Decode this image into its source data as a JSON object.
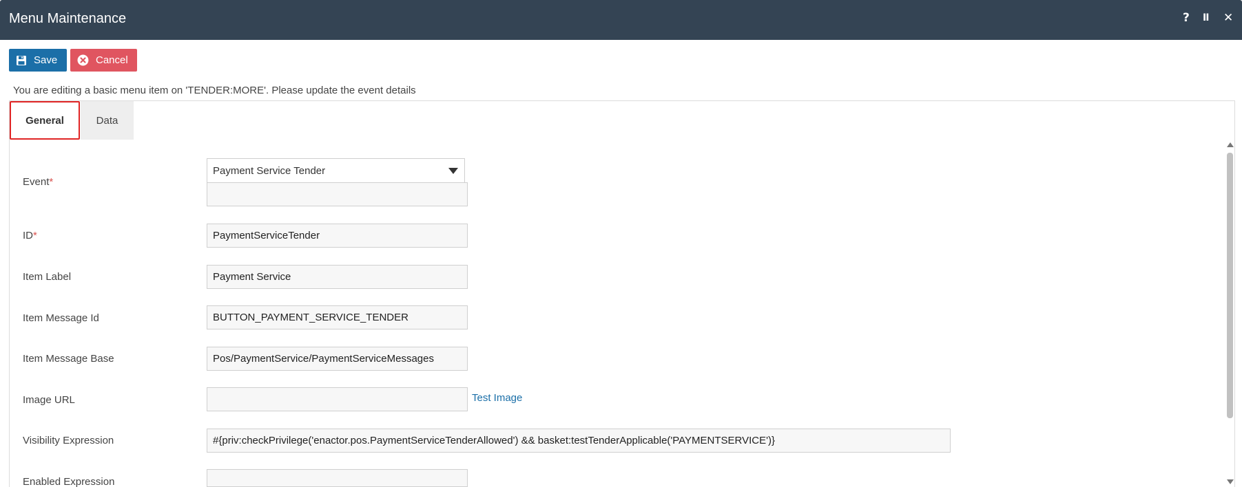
{
  "window": {
    "title": "Menu Maintenance",
    "help_icon": "?",
    "pause_icon": "II",
    "close_icon": "✕"
  },
  "toolbar": {
    "save_label": "Save",
    "cancel_label": "Cancel",
    "save_icon": "floppy-disk-icon",
    "cancel_icon": "x-circle-icon"
  },
  "info_text": "You are editing a basic menu item on 'TENDER:MORE'. Please update the event details",
  "tabs": [
    {
      "label": "General",
      "active": true
    },
    {
      "label": "Data",
      "active": false
    }
  ],
  "form": {
    "event": {
      "label": "Event",
      "required_mark": "*",
      "value": "Payment Service Tender",
      "secondary_value": ""
    },
    "id": {
      "label": "ID",
      "required_mark": "*",
      "value": "PaymentServiceTender"
    },
    "item_label": {
      "label": "Item Label",
      "value": "Payment Service"
    },
    "item_message_id": {
      "label": "Item Message Id",
      "value": "BUTTON_PAYMENT_SERVICE_TENDER"
    },
    "item_message_base": {
      "label": "Item Message Base",
      "value": "Pos/PaymentService/PaymentServiceMessages"
    },
    "image_url": {
      "label": "Image URL",
      "value": "",
      "test_link": "Test Image"
    },
    "visibility_expression": {
      "label": "Visibility Expression",
      "value": "#{priv:checkPrivilege('enactor.pos.PaymentServiceTenderAllowed') && basket:testTenderApplicable('PAYMENTSERVICE')}"
    },
    "enabled_expression": {
      "label": "Enabled Expression",
      "value": ""
    }
  },
  "colors": {
    "titlebar": "#344454",
    "save_button": "#1b6fa8",
    "cancel_button": "#e05560",
    "active_tab_border": "#e02424",
    "link": "#1b6fa8",
    "required": "#d9534f"
  }
}
